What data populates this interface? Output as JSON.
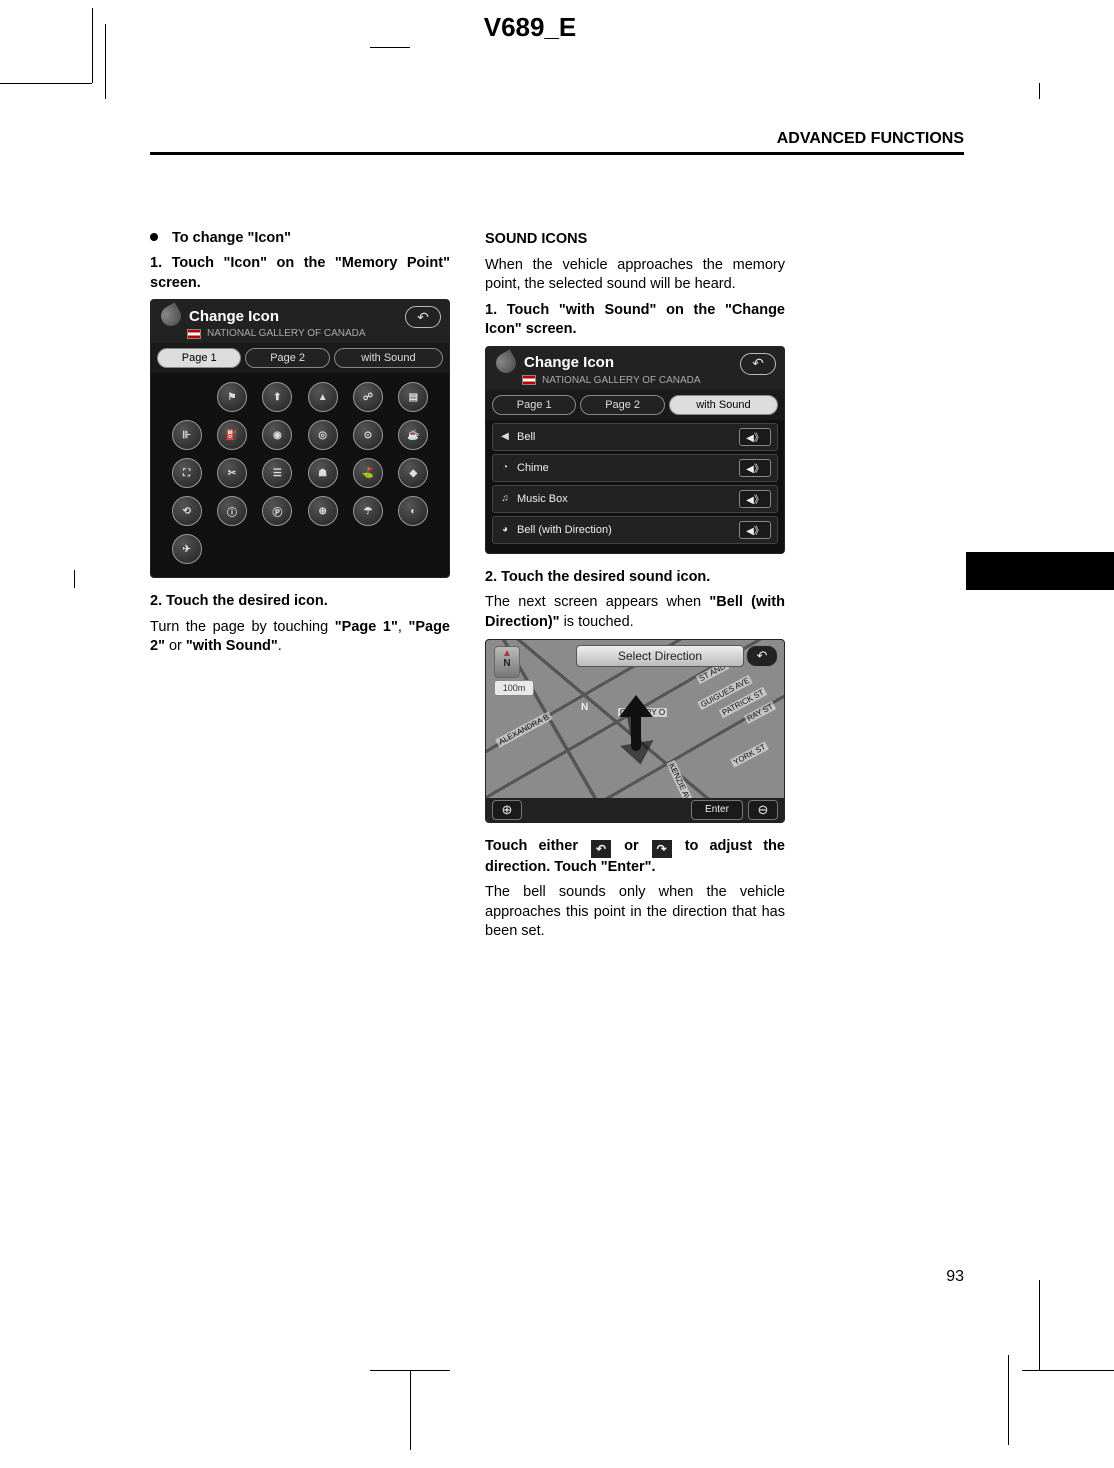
{
  "doc_header": "V689_E",
  "section_header": "ADVANCED FUNCTIONS",
  "page_number": "93",
  "left": {
    "bullet": "To change \"Icon\"",
    "step1": "1. Touch \"Icon\" on the \"Memory Point\" screen.",
    "step2": "2.   Touch the desired icon.",
    "body1_a": "Turn the page by touching ",
    "body1_b": "\"Page 1\"",
    "body1_c": ", ",
    "body1_d": "\"Page 2\"",
    "body1_e": " or ",
    "body1_f": "\"with Sound\"",
    "body1_g": "."
  },
  "right": {
    "heading": "SOUND ICONS",
    "intro": "When the vehicle approaches the memory point, the selected sound will be heard.",
    "step1": "1. Touch \"with Sound\" on the \"Change Icon\" screen.",
    "step2": "2.   Touch the desired sound icon.",
    "body2_a": "The next screen appears when ",
    "body2_b": "\"Bell (with Direction)\"",
    "body2_c": " is touched.",
    "step3_a": "Touch either ",
    "step3_b": " or ",
    "step3_c": " to adjust the direction.   Touch \"Enter\".",
    "body3": "The bell sounds only when the vehicle approaches this point in the direction that has been set."
  },
  "shot1": {
    "title": "Change Icon",
    "subtitle": "NATIONAL GALLERY OF CANADA",
    "tabs": {
      "p1": "Page 1",
      "p2": "Page 2",
      "ws": "with Sound"
    },
    "icons": [
      "⚑",
      "⬆",
      "▲",
      "☍",
      "▤",
      "⊪",
      "⛽",
      "◉",
      "◎",
      "⊙",
      "☕",
      "⛶",
      "✂",
      "☰",
      "☗",
      "⛳",
      "◆",
      "⟲",
      "ⓘ",
      "Ⓟ",
      "⊕",
      "☂",
      "◐",
      "✈"
    ]
  },
  "shot2": {
    "title": "Change Icon",
    "subtitle": "NATIONAL GALLERY OF CANADA",
    "tabs": {
      "p1": "Page 1",
      "p2": "Page 2",
      "ws": "with Sound"
    },
    "rows": [
      {
        "icon": "◀",
        "label": "Bell"
      },
      {
        "icon": "◔",
        "label": "Chime"
      },
      {
        "icon": "♫",
        "label": "Music Box"
      },
      {
        "icon": "◕",
        "label": "Bell (with Direction)"
      }
    ],
    "play": "◀》"
  },
  "shot3": {
    "title": "Select Direction",
    "compass": "⬆\nN",
    "scale": "100m",
    "enter": "Enter",
    "gallery": "GALLERY O",
    "streets": [
      "ST AND",
      "GUIGUES AVE",
      "PATRICK ST",
      "RAY ST",
      "YORK ST",
      "ALEXANDRA B",
      "KENZIE AVE"
    ]
  }
}
